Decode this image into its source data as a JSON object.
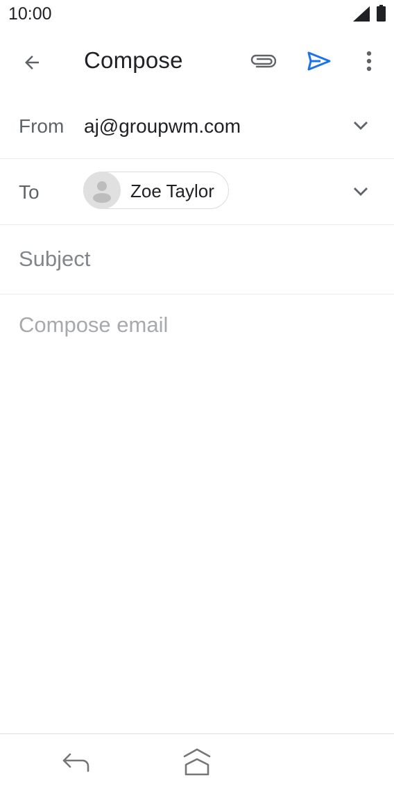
{
  "status_bar": {
    "time": "10:00",
    "icons": [
      "signal-icon",
      "battery-icon"
    ]
  },
  "app_bar": {
    "title": "Compose",
    "icons": [
      "arrow-back-icon",
      "paperclip-icon",
      "send-icon",
      "more-vertical-icon"
    ]
  },
  "from": {
    "label": "From",
    "value": "aj@groupwm.com",
    "icon": "chevron-down-icon"
  },
  "to": {
    "label": "To",
    "recipient_name": "Zoe Taylor",
    "avatar_icon": "person-icon",
    "icon": "chevron-down-icon"
  },
  "subject": {
    "placeholder": "Subject",
    "value": ""
  },
  "body": {
    "placeholder": "Compose email",
    "value": ""
  },
  "nav_bar": {
    "icons": [
      "nav-back-icon",
      "nav-home-icon"
    ]
  },
  "colors": {
    "accent": "#1a73e8",
    "text_primary": "#202124",
    "text_secondary": "#5f6368",
    "divider": "#e8eaed"
  }
}
